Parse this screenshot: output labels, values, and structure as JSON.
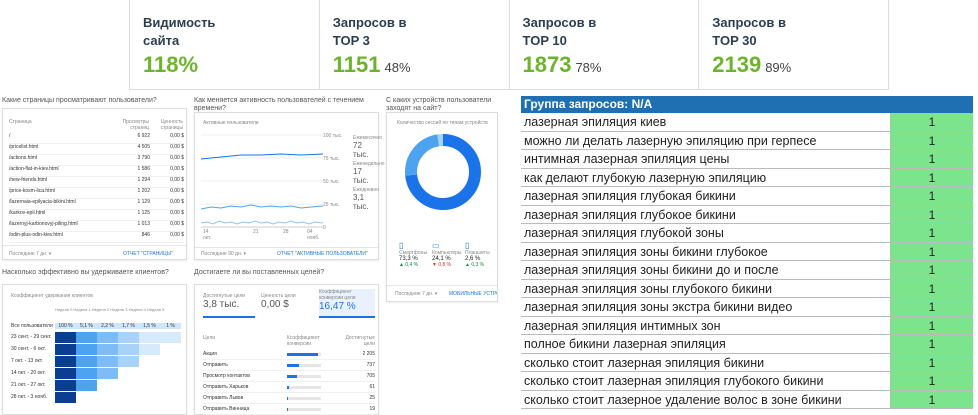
{
  "metrics": [
    {
      "label": "Видимость сайта",
      "value": "118%",
      "pct": ""
    },
    {
      "label": "Запросов в TOP 3",
      "value": "1151",
      "pct": "48%"
    },
    {
      "label": "Запросов в TOP 10",
      "value": "1873",
      "pct": "78%"
    },
    {
      "label": "Запросов в TOP 30",
      "value": "2139",
      "pct": "89%"
    }
  ],
  "pages_card": {
    "question": "Какие страницы просматривают пользователи?",
    "col_page": "Страница",
    "col_views": "Просмотры страниц",
    "col_value": "Ценность страницы",
    "rows": [
      {
        "page": "/",
        "views": "6 922",
        "value": "0,00 $"
      },
      {
        "page": "/pricelist.html",
        "views": "4 505",
        "value": "0,00 $"
      },
      {
        "page": "/actions.html",
        "views": "3 790",
        "value": "0,00 $"
      },
      {
        "page": "/action-flat-in-kiev.html",
        "views": "1 586",
        "value": "0,00 $"
      },
      {
        "page": "/new-friends.html",
        "views": "1 294",
        "value": "0,00 $"
      },
      {
        "page": "/price-kosm-lica.html",
        "views": "1 202",
        "value": "0,00 $"
      },
      {
        "page": "/lazernaia-epilyacia-bikini.html",
        "views": "1 129",
        "value": "0,00 $"
      },
      {
        "page": "/karkov-epil.html",
        "views": "1 125",
        "value": "0,00 $"
      },
      {
        "page": "/lazernyj-karbonovyj-piling.html",
        "views": "1 013",
        "value": "0,00 $"
      },
      {
        "page": "/odin-plus-odin-kiev.html",
        "views": "846",
        "value": "0,00 $"
      }
    ],
    "period": "Последние 7 дн. ▾",
    "report": "ОТЧЕТ \"СТРАНИЦЫ\""
  },
  "activity_card": {
    "question": "Как меняется активность пользователей с течением времени?",
    "title": "Активные пользователи",
    "ticks": [
      "100 тыс.",
      "75 тыс.",
      "50 тыс.",
      "25 тыс.",
      "0"
    ],
    "xticks": [
      "14 окт.",
      "21",
      "28",
      "04 нояб."
    ],
    "legend": [
      {
        "label": "Ежемесячно",
        "value": "72 тыс."
      },
      {
        "label": "Еженедельно",
        "value": "17 тыс."
      },
      {
        "label": "Ежедневно",
        "value": "3,1 тыс."
      }
    ],
    "period": "Последние 90 дн. ▾",
    "report": "ОТЧЕТ \"АКТИВНЫЕ ПОЛЬЗОВАТЕЛИ\""
  },
  "devices_card": {
    "question": "С каких устройств пользователи заходят на сайт?",
    "title": "Количество сессий по типам устройств",
    "devices": [
      {
        "name": "Смартфоны",
        "pct": "73,3 %",
        "change": "▲ 0,4 %"
      },
      {
        "name": "Компьютеры",
        "pct": "24,1 %",
        "change": "▼ 0,8 %"
      },
      {
        "name": "Планшеты",
        "pct": "2,6 %",
        "change": "▲ 0,3 %"
      }
    ],
    "period": "Последние 7 дн. ▾",
    "report": "МОБИЛЬНЫЕ УСТРОЙСТВА"
  },
  "retention_card": {
    "question": "Насколько эффективно вы удерживаете клиентов?",
    "title": "Коэффициент удержания клиентов",
    "col_header": "Неделя 0 Неделя 1 Неделя 2 Неделя 3 Неделя 4 Неделя 5",
    "all_users": "Все пользователи",
    "all_pcts": [
      "100 %",
      "5,1 %",
      "2,2 %",
      "1,7 %",
      "1,5 %",
      "1 %"
    ],
    "rows": [
      "23 сент. - 29 сент.",
      "30 сент. - 6 окт.",
      "7 окт. - 13 окт.",
      "14 окт. - 20 окт.",
      "21 окт. - 27 окт.",
      "28 окт. - 3 нояб."
    ]
  },
  "goals_card": {
    "question": "Достигаете ли вы поставленных целей?",
    "kpis": [
      {
        "label": "Достигнутые цели",
        "value": "3,8 тыс."
      },
      {
        "label": "Ценность цели",
        "value": "0,00 $"
      },
      {
        "label": "Коэффициент конверсии цели",
        "value": "16,47 %"
      }
    ],
    "col_goal": "Цели",
    "col_rate": "Коэффициент конверсии",
    "col_done": "Достигнутые цели",
    "rows": [
      {
        "goal": "Акция",
        "done": "2 205"
      },
      {
        "goal": "Отправить",
        "done": "737"
      },
      {
        "goal": "Просмотр контактов",
        "done": "705"
      },
      {
        "goal": "Отправить Харьков",
        "done": "61"
      },
      {
        "goal": "Отправить Львов",
        "done": "25"
      },
      {
        "goal": "Отправить Винница",
        "done": "19"
      }
    ]
  },
  "keywords": {
    "header": "Группа запросов: N/A",
    "rows": [
      {
        "text": "лазерная эпиляция киев",
        "value": "1"
      },
      {
        "text": "можно ли делать лазерную эпиляцию при герпесе",
        "value": "1"
      },
      {
        "text": "интимная лазерная эпиляция цены",
        "value": "1"
      },
      {
        "text": "как делают глубокую лазерную эпиляцию",
        "value": "1"
      },
      {
        "text": "лазерная эпиляция глубокая бикини",
        "value": "1"
      },
      {
        "text": "лазерная эпиляция глубокое бикини",
        "value": "1"
      },
      {
        "text": "лазерная эпиляция глубокой зоны",
        "value": "1"
      },
      {
        "text": "лазерная эпиляция зоны бикини глубокое",
        "value": "1"
      },
      {
        "text": "лазерная эпиляция зоны бикини до и после",
        "value": "1"
      },
      {
        "text": "лазерная эпиляция зоны глубокого бикини",
        "value": "1"
      },
      {
        "text": "лазерная эпиляция зоны экстра бикини видео",
        "value": "1"
      },
      {
        "text": "лазерная эпиляция интимных зон",
        "value": "1"
      },
      {
        "text": "полное бикини лазерная эпиляция",
        "value": "1"
      },
      {
        "text": "сколько стоит лазерная эпиляция бикини",
        "value": "1"
      },
      {
        "text": "сколько стоит лазерная эпиляция глубокого бикини",
        "value": "1"
      },
      {
        "text": "сколько стоит лазерное удаление волос в зоне бикини",
        "value": "1"
      }
    ]
  }
}
